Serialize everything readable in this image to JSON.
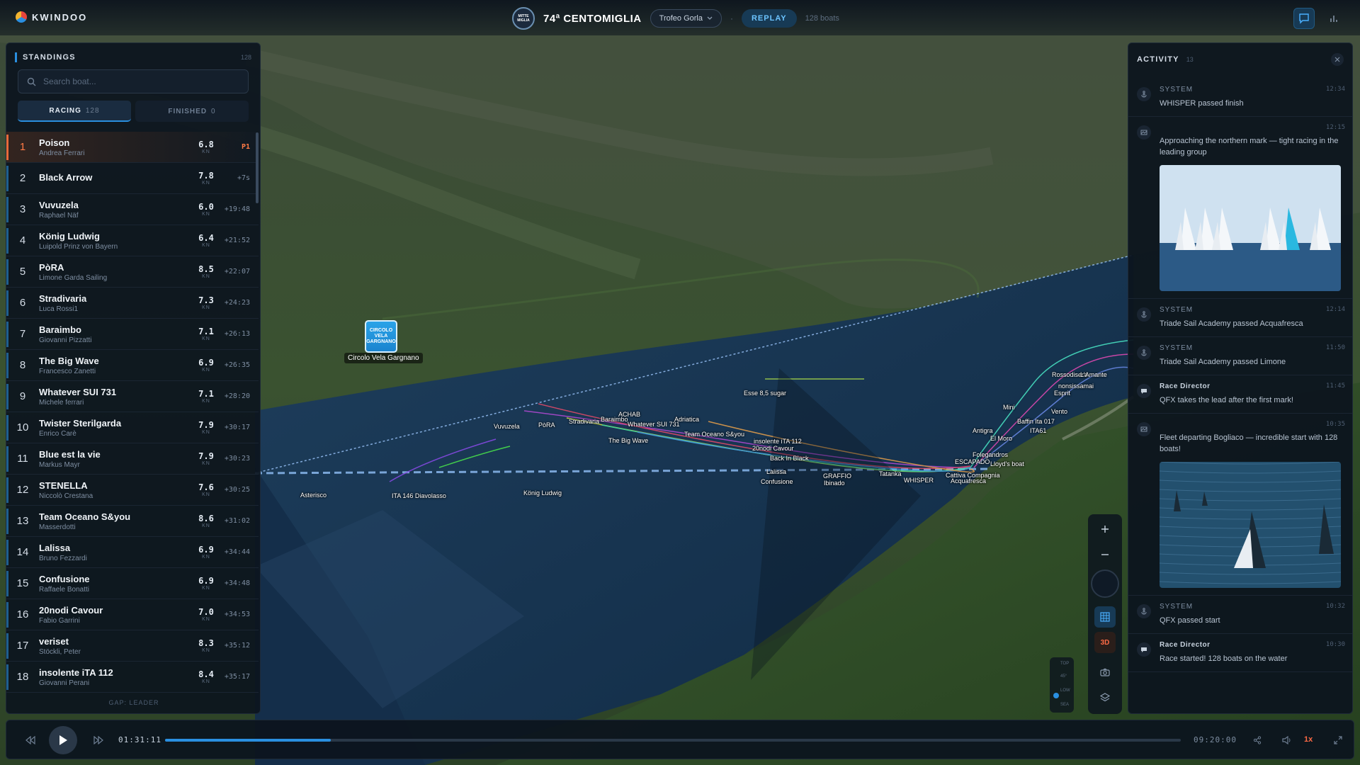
{
  "brand": {
    "name": "KWINDOO"
  },
  "event": {
    "badge": "MITTE MIGLIA",
    "title": "74ª CENTOMIGLIA",
    "trophy": "Trofeo Gorla",
    "separator": "·",
    "mode": "REPLAY",
    "boats": "128 boats"
  },
  "standings": {
    "title": "STANDINGS",
    "count": "128",
    "search_placeholder": "Search boat...",
    "tabs": [
      {
        "label": "RACING",
        "count": "128"
      },
      {
        "label": "FINISHED",
        "count": "0"
      }
    ],
    "unit": "KN",
    "rows": [
      {
        "pos": "1",
        "name": "Poison",
        "skipper": "Andrea Ferrari",
        "speed": "6.8",
        "gap": "P1"
      },
      {
        "pos": "2",
        "name": "Black Arrow",
        "skipper": "",
        "speed": "7.8",
        "gap": "+7s"
      },
      {
        "pos": "3",
        "name": "Vuvuzela",
        "skipper": "Raphael Näf",
        "speed": "6.0",
        "gap": "+19:48"
      },
      {
        "pos": "4",
        "name": "König Ludwig",
        "skipper": "Luipold Prinz von Bayern",
        "speed": "6.4",
        "gap": "+21:52"
      },
      {
        "pos": "5",
        "name": "PòRA",
        "skipper": "Limone Garda Sailing",
        "speed": "8.5",
        "gap": "+22:07"
      },
      {
        "pos": "6",
        "name": "Stradivaria",
        "skipper": "Luca Rossi1",
        "speed": "7.3",
        "gap": "+24:23"
      },
      {
        "pos": "7",
        "name": "Baraimbo",
        "skipper": "Giovanni Pizzatti",
        "speed": "7.1",
        "gap": "+26:13"
      },
      {
        "pos": "8",
        "name": "The Big Wave",
        "skipper": "Francesco Zanetti",
        "speed": "6.9",
        "gap": "+26:35"
      },
      {
        "pos": "9",
        "name": "Whatever SUI 731",
        "skipper": "Michele ferrari",
        "speed": "7.1",
        "gap": "+28:20"
      },
      {
        "pos": "10",
        "name": "Twister Sterilgarda",
        "skipper": "Enrico Carè",
        "speed": "7.9",
        "gap": "+30:17"
      },
      {
        "pos": "11",
        "name": "Blue est la vie",
        "skipper": "Markus Mayr",
        "speed": "7.9",
        "gap": "+30:23"
      },
      {
        "pos": "12",
        "name": "STENELLA",
        "skipper": "Niccolò Crestana",
        "speed": "7.6",
        "gap": "+30:25"
      },
      {
        "pos": "13",
        "name": "Team Oceano S&you",
        "skipper": "Masserdotti",
        "speed": "8.6",
        "gap": "+31:02"
      },
      {
        "pos": "14",
        "name": "Lalissa",
        "skipper": "Bruno Fezzardi",
        "speed": "6.9",
        "gap": "+34:44"
      },
      {
        "pos": "15",
        "name": "Confusione",
        "skipper": "Raffaele Bonatti",
        "speed": "6.9",
        "gap": "+34:48"
      },
      {
        "pos": "16",
        "name": "20nodi Cavour",
        "skipper": "Fabio Garrini",
        "speed": "7.0",
        "gap": "+34:53"
      },
      {
        "pos": "17",
        "name": "veriset",
        "skipper": "Stöckli, Peter",
        "speed": "8.3",
        "gap": "+35:12"
      },
      {
        "pos": "18",
        "name": "insolente iTA 112",
        "skipper": "Giovanni Perani",
        "speed": "8.4",
        "gap": "+35:17"
      }
    ],
    "footer": "GAP: LEADER"
  },
  "activity": {
    "title": "ACTIVITY",
    "count": "13",
    "items": [
      {
        "type": "system",
        "who": "SYSTEM",
        "time": "12:34",
        "msg": "WHISPER passed finish",
        "photo": ""
      },
      {
        "type": "media",
        "who": "",
        "time": "12:15",
        "msg": "Approaching the northern mark — tight racing in the leading group",
        "photo": "sails"
      },
      {
        "type": "system",
        "who": "SYSTEM",
        "time": "12:14",
        "msg": "Triade Sail Academy passed Acquafresca",
        "photo": ""
      },
      {
        "type": "system",
        "who": "SYSTEM",
        "time": "11:50",
        "msg": "Triade Sail Academy passed Limone",
        "photo": ""
      },
      {
        "type": "director",
        "who": "Race Director",
        "time": "11:45",
        "msg": "QFX takes the lead after the first mark!",
        "photo": ""
      },
      {
        "type": "media",
        "who": "",
        "time": "10:35",
        "msg": "Fleet departing Bogliaco — incredible start with 128 boats!",
        "photo": "fleet"
      },
      {
        "type": "system",
        "who": "SYSTEM",
        "time": "10:32",
        "msg": "QFX passed start",
        "photo": ""
      },
      {
        "type": "director",
        "who": "Race Director",
        "time": "10:30",
        "msg": "Race started! 128 boats on the water",
        "photo": ""
      }
    ]
  },
  "map": {
    "club_marker": "CIRCOLO VELA GARGNANO",
    "club_caption": "Circolo Vela Gargnano",
    "controls": {
      "three_d": "3D"
    },
    "tilt": [
      "TOP",
      "45°",
      "LOW",
      "SEA"
    ]
  },
  "player": {
    "current": "01:31:11",
    "end": "09:20:00",
    "progress": 0.163,
    "speed": "1x"
  },
  "colors": {
    "accent": "#2a8fe0",
    "leader": "#ff7a45",
    "panel": "#0c141e"
  }
}
